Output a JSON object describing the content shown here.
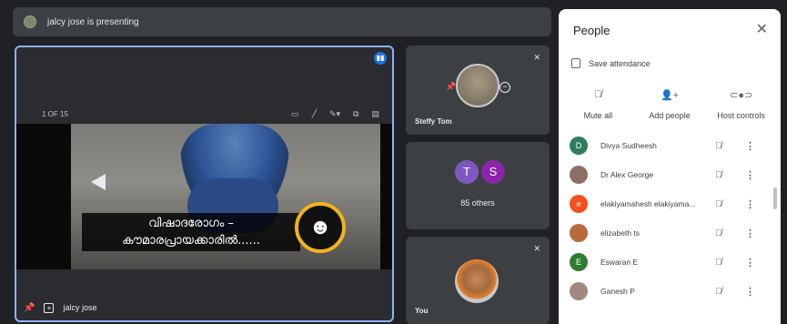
{
  "presenting_bar": {
    "text": "jalcy jose is presenting"
  },
  "main_tile": {
    "slide_counter": "1 OF 15",
    "slide_text_line1": "വിഷാദരോഗം –",
    "slide_text_line2": "കൗമാരപ്രായക്കാരിൽ......",
    "presenter_name": "jalcy jose"
  },
  "side_tiles": [
    {
      "name": "Steffy Tom"
    },
    {
      "initials": [
        "T",
        "S"
      ],
      "label": "85 others"
    },
    {
      "name": "You"
    }
  ],
  "people_panel": {
    "title": "People",
    "save_attendance": "Save attendance",
    "actions": [
      {
        "label": "Mute all",
        "icon": "mic-off-icon"
      },
      {
        "label": "Add people",
        "icon": "add-person-icon"
      },
      {
        "label": "Host controls",
        "icon": "toggle-icon"
      }
    ],
    "participants": [
      {
        "initial": "D",
        "name": "Divya Sudheesh",
        "color": "#2e7d5b"
      },
      {
        "initial": "",
        "name": "Dr Alex George",
        "color": "#8d6e63"
      },
      {
        "initial": "e",
        "name": "elakiyamahesh elakiyama...",
        "color": "#f4511e"
      },
      {
        "initial": "",
        "name": "elizabeth ts",
        "color": "#b86b3a"
      },
      {
        "initial": "E",
        "name": "Eswaran E",
        "color": "#2e7d32"
      },
      {
        "initial": "",
        "name": "Ganesh P",
        "color": "#a1887f"
      }
    ]
  }
}
